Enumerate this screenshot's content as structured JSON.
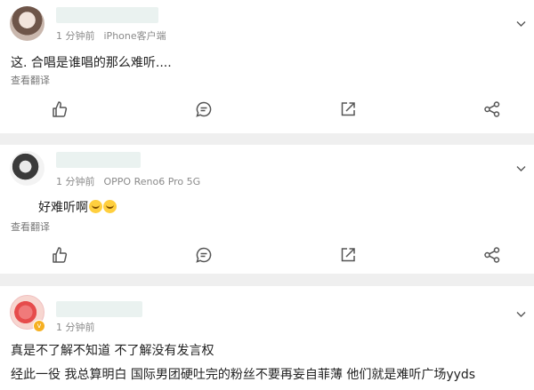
{
  "posts": [
    {
      "meta_time": "1 分钟前",
      "meta_source": "iPhone客户端",
      "content": "这.    合唱是谁唱的那么难听....",
      "translate": "查看翻译"
    },
    {
      "meta_time": "1 分钟前",
      "meta_source": "OPPO Reno6 Pro 5G",
      "content": "好难听啊",
      "translate": "查看翻译",
      "emoji_count": 2
    },
    {
      "meta_time": "1 分钟前",
      "meta_source": "",
      "content_line1": "真是不了解不知道 不了解没有发言权",
      "content_line2": "经此一役 我总算明白 国际男团硬吐完的粉丝不要再妄自菲薄 他们就是难听广场yyds"
    }
  ],
  "icons": {
    "like": "thumbs-up-icon",
    "comment": "comment-icon",
    "repost": "repost-icon",
    "share": "share-icon",
    "more": "chevron-down-icon"
  }
}
